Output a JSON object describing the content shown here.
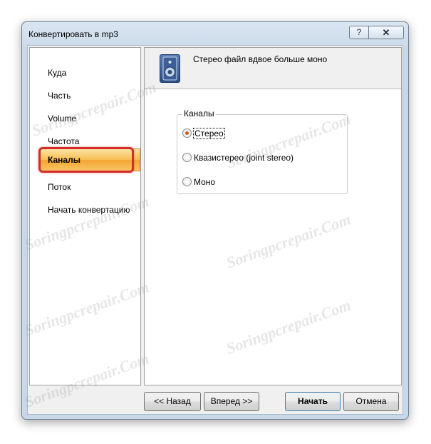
{
  "window": {
    "title": "Конвертировать в mp3",
    "help_label": "?",
    "close_label": "✕"
  },
  "sidebar": {
    "items": [
      {
        "label": "Куда"
      },
      {
        "label": "Часть"
      },
      {
        "label": "Volume"
      },
      {
        "label": "Частота"
      },
      {
        "label": "Каналы",
        "active": true
      },
      {
        "label": "Поток"
      },
      {
        "label": "Начать конвертацию"
      }
    ]
  },
  "header": {
    "icon": "speaker-icon",
    "text": "Стерео файл вдвое больше моно"
  },
  "channels": {
    "group_label": "Каналы",
    "options": [
      {
        "label": "Стерео",
        "selected": true
      },
      {
        "label": "Квазистерео (joint stereo)",
        "selected": false
      },
      {
        "label": "Моно",
        "selected": false
      }
    ]
  },
  "buttons": {
    "back": "<< Назад",
    "next": "Вперед >>",
    "start": "Начать",
    "cancel": "Отмена"
  },
  "watermark": "Soringpcrepair.Com"
}
